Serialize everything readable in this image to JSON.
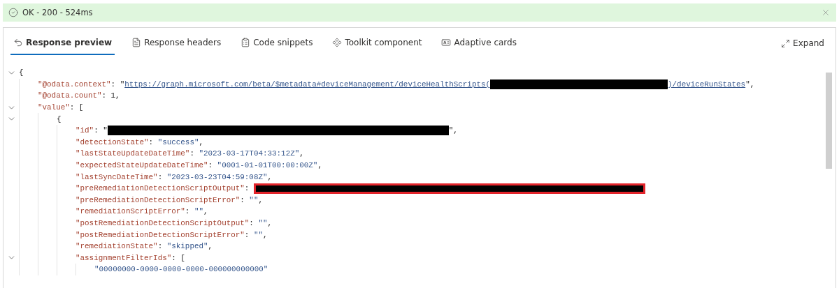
{
  "status": {
    "text": "OK - 200 - 524ms",
    "ok": true
  },
  "tabs": [
    {
      "label": "Response preview",
      "selected": true
    },
    {
      "label": "Response headers",
      "selected": false
    },
    {
      "label": "Code snippets",
      "selected": false
    },
    {
      "label": "Toolkit component",
      "selected": false
    },
    {
      "label": "Adaptive cards",
      "selected": false
    }
  ],
  "expand": {
    "label": "Expand"
  },
  "lines": [
    {
      "kind": "toggle",
      "expanded": true,
      "tokens": [
        {
          "kind": "punct",
          "text": "{"
        }
      ],
      "children": [
        {
          "kind": "plain",
          "tokens": [
            {
              "kind": "key",
              "text": "\"@odata.context\""
            },
            {
              "kind": "punct",
              "text": ": \""
            },
            {
              "kind": "link",
              "text": "https://graph.microsoft.com/beta/$metadata#deviceManagement/deviceHealthScripts("
            },
            {
              "kind": "linkmask",
              "flagged": false
            },
            {
              "kind": "link",
              "text": ")/deviceRunStates"
            },
            {
              "kind": "punct",
              "text": "\","
            }
          ]
        },
        {
          "kind": "plain",
          "tokens": [
            {
              "kind": "key",
              "text": "\"@odata.count\""
            },
            {
              "kind": "punct",
              "text": ": 1,"
            }
          ]
        },
        {
          "kind": "toggle",
          "expanded": true,
          "tokens": [
            {
              "kind": "key",
              "text": "\"value\""
            },
            {
              "kind": "punct",
              "text": ": ["
            }
          ],
          "children": [
            {
              "kind": "toggle",
              "expanded": true,
              "tokens": [
                {
                  "kind": "punct",
                  "text": "{"
                }
              ],
              "children": [
                {
                  "kind": "plain",
                  "tokens": [
                    {
                      "kind": "key",
                      "text": "\"id\""
                    },
                    {
                      "kind": "punct",
                      "text": ": \""
                    },
                    {
                      "kind": "mask",
                      "flagged": false
                    },
                    {
                      "kind": "punct",
                      "text": "\","
                    }
                  ]
                },
                {
                  "kind": "plain",
                  "tokens": [
                    {
                      "kind": "key",
                      "text": "\"detectionState\""
                    },
                    {
                      "kind": "punct",
                      "text": ": "
                    },
                    {
                      "kind": "string",
                      "text": "\"success\""
                    },
                    {
                      "kind": "punct",
                      "text": ","
                    }
                  ]
                },
                {
                  "kind": "plain",
                  "tokens": [
                    {
                      "kind": "key",
                      "text": "\"lastStateUpdateDateTime\""
                    },
                    {
                      "kind": "punct",
                      "text": ": "
                    },
                    {
                      "kind": "string",
                      "text": "\"2023-03-17T04:33:12Z\""
                    },
                    {
                      "kind": "punct",
                      "text": ","
                    }
                  ]
                },
                {
                  "kind": "plain",
                  "tokens": [
                    {
                      "kind": "key",
                      "text": "\"expectedStateUpdateDateTime\""
                    },
                    {
                      "kind": "punct",
                      "text": ": "
                    },
                    {
                      "kind": "string",
                      "text": "\"0001-01-01T00:00:00Z\""
                    },
                    {
                      "kind": "punct",
                      "text": ","
                    }
                  ]
                },
                {
                  "kind": "plain",
                  "tokens": [
                    {
                      "kind": "key",
                      "text": "\"lastSyncDateTime\""
                    },
                    {
                      "kind": "punct",
                      "text": ": "
                    },
                    {
                      "kind": "string",
                      "text": "\"2023-03-23T04:59:08Z\""
                    },
                    {
                      "kind": "punct",
                      "text": ","
                    }
                  ]
                },
                {
                  "kind": "plain",
                  "tokens": [
                    {
                      "kind": "key",
                      "text": "\"preRemediationDetectionScriptOutput\""
                    },
                    {
                      "kind": "punct",
                      "text": ": "
                    },
                    {
                      "kind": "mask",
                      "flagged": true
                    }
                  ]
                },
                {
                  "kind": "plain",
                  "tokens": [
                    {
                      "kind": "key",
                      "text": "\"preRemediationDetectionScriptError\""
                    },
                    {
                      "kind": "punct",
                      "text": ": "
                    },
                    {
                      "kind": "string",
                      "text": "\"\""
                    },
                    {
                      "kind": "punct",
                      "text": ","
                    }
                  ]
                },
                {
                  "kind": "plain",
                  "tokens": [
                    {
                      "kind": "key",
                      "text": "\"remediationScriptError\""
                    },
                    {
                      "kind": "punct",
                      "text": ": "
                    },
                    {
                      "kind": "string",
                      "text": "\"\""
                    },
                    {
                      "kind": "punct",
                      "text": ","
                    }
                  ]
                },
                {
                  "kind": "plain",
                  "tokens": [
                    {
                      "kind": "key",
                      "text": "\"postRemediationDetectionScriptOutput\""
                    },
                    {
                      "kind": "punct",
                      "text": ": "
                    },
                    {
                      "kind": "string",
                      "text": "\"\""
                    },
                    {
                      "kind": "punct",
                      "text": ","
                    }
                  ]
                },
                {
                  "kind": "plain",
                  "tokens": [
                    {
                      "kind": "key",
                      "text": "\"postRemediationDetectionScriptError\""
                    },
                    {
                      "kind": "punct",
                      "text": ": "
                    },
                    {
                      "kind": "string",
                      "text": "\"\""
                    },
                    {
                      "kind": "punct",
                      "text": ","
                    }
                  ]
                },
                {
                  "kind": "plain",
                  "tokens": [
                    {
                      "kind": "key",
                      "text": "\"remediationState\""
                    },
                    {
                      "kind": "punct",
                      "text": ": "
                    },
                    {
                      "kind": "string",
                      "text": "\"skipped\""
                    },
                    {
                      "kind": "punct",
                      "text": ","
                    }
                  ]
                },
                {
                  "kind": "toggle",
                  "expanded": true,
                  "tokens": [
                    {
                      "kind": "key",
                      "text": "\"assignmentFilterIds\""
                    },
                    {
                      "kind": "punct",
                      "text": ": ["
                    }
                  ],
                  "children": [
                    {
                      "kind": "plain",
                      "tokens": [
                        {
                          "kind": "string",
                          "text": "\"00000000-0000-0000-0000-000000000000\""
                        }
                      ]
                    }
                  ]
                }
              ]
            }
          ]
        }
      ]
    }
  ]
}
